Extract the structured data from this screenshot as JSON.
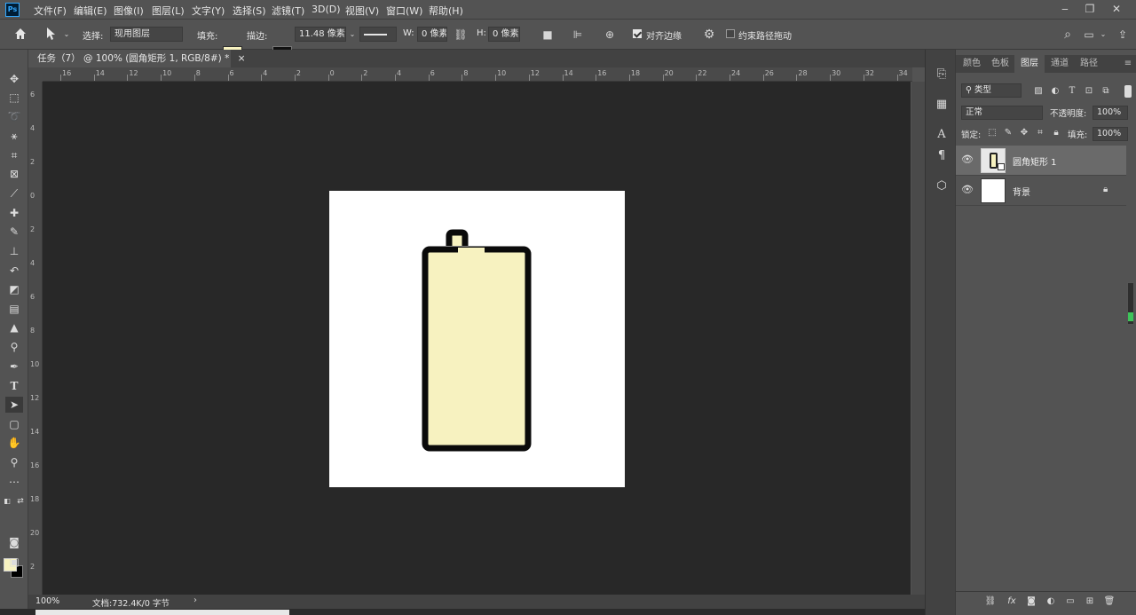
{
  "app": {
    "logo_text": "Ps"
  },
  "menu": [
    "文件(F)",
    "编辑(E)",
    "图像(I)",
    "图层(L)",
    "文字(Y)",
    "选择(S)",
    "滤镜(T)",
    "3D(D)",
    "视图(V)",
    "窗口(W)",
    "帮助(H)"
  ],
  "options_bar": {
    "select_label": "选择:",
    "select_value": "现用图层",
    "fill_label": "填充:",
    "fill_color": "#f7f2c0",
    "stroke_label": "描边:",
    "stroke_width": "11.48 像素",
    "w_label": "W:",
    "w_value": "0 像素",
    "h_label": "H:",
    "h_value": "0 像素",
    "align_edges_label": "对齐边缘",
    "align_edges_checked": true,
    "constrain_path_label": "约束路径拖动",
    "constrain_path_checked": false
  },
  "document": {
    "tab_title": "任务（7） @ 100% (圆角矩形 1, RGB/8#) *",
    "close_glyph": "×"
  },
  "rulers": {
    "top_labels": [
      "16",
      "14",
      "12",
      "10",
      "8",
      "6",
      "4",
      "2",
      "0",
      "2",
      "4",
      "6",
      "8",
      "10",
      "12",
      "14",
      "16",
      "18",
      "20",
      "22",
      "24",
      "26",
      "28",
      "30",
      "32",
      "34"
    ],
    "left_labels": [
      "6",
      "4",
      "2",
      "0",
      "2",
      "4",
      "6",
      "8",
      "10",
      "12",
      "14",
      "16",
      "18",
      "20",
      "2"
    ]
  },
  "canvas": {
    "shape_fill": "#f7f2c0",
    "shape_stroke": "#0a0a0a"
  },
  "status": {
    "zoom": "100%",
    "doc_info": "文档:732.4K/0 字节",
    "arrow": "›"
  },
  "panel": {
    "tabs": [
      "颜色",
      "色板",
      "图层",
      "通道",
      "路径"
    ],
    "active_tab": "图层",
    "filter_kind": "类型",
    "blend_mode": "正常",
    "opacity_label": "不透明度:",
    "opacity_value": "100%",
    "lock_label": "锁定:",
    "fill_label": "填充:",
    "fill_value": "100%",
    "layers": [
      {
        "name": "圆角矩形 1",
        "selected": true,
        "locked": false
      },
      {
        "name": "背景",
        "selected": false,
        "locked": true
      }
    ]
  }
}
